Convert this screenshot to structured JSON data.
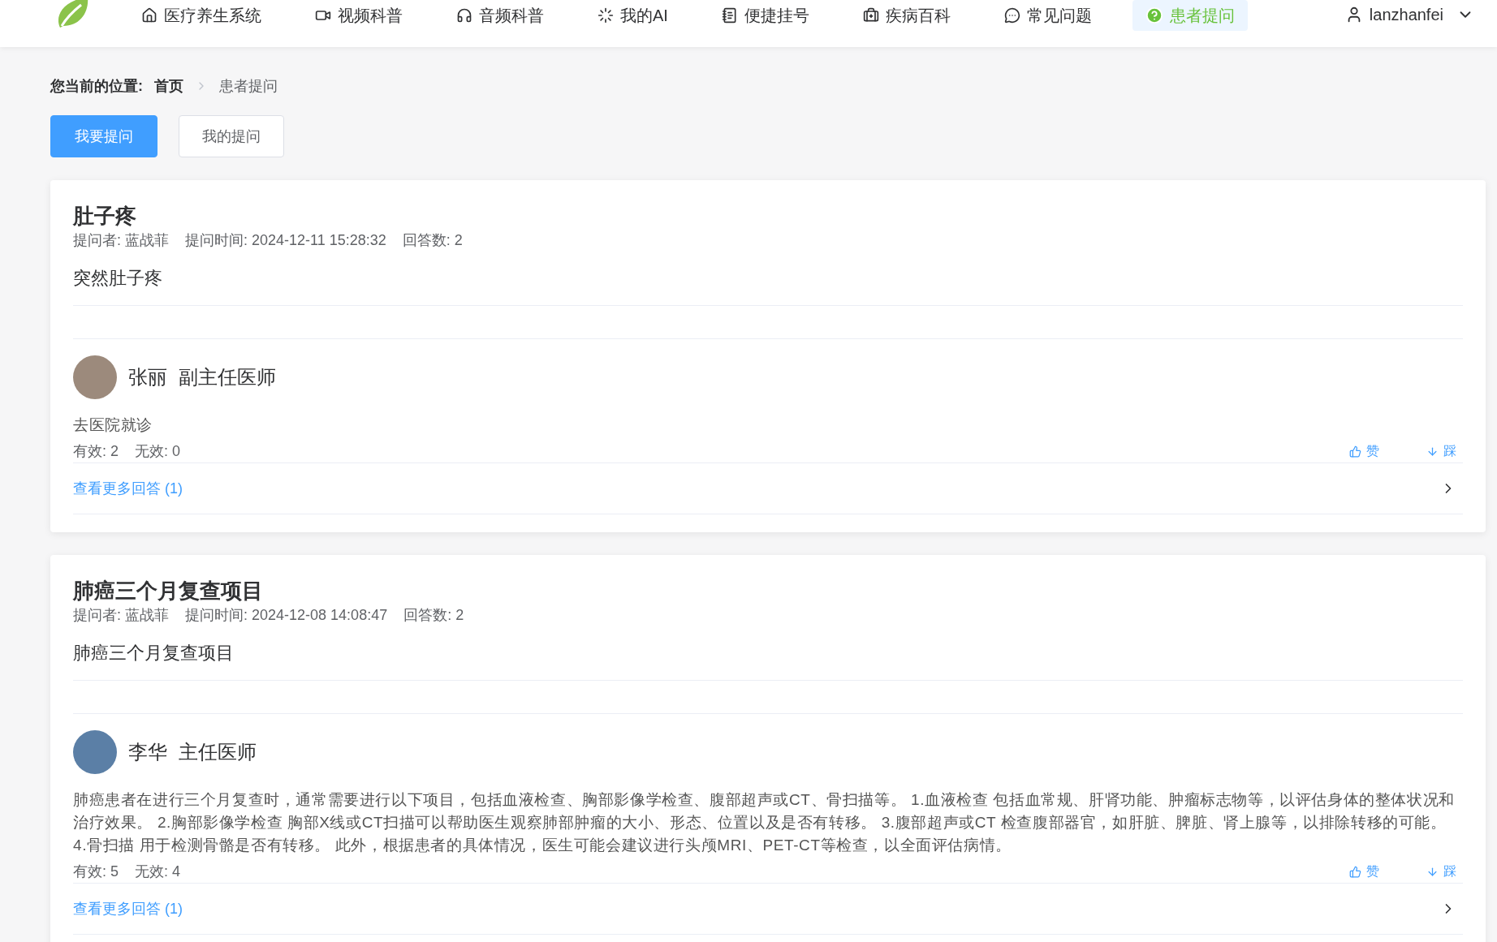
{
  "nav": {
    "items": [
      {
        "label": "医疗养生系统",
        "selected": false
      },
      {
        "label": "视频科普",
        "selected": false
      },
      {
        "label": "音频科普",
        "selected": false
      },
      {
        "label": "我的AI",
        "selected": false
      },
      {
        "label": "便捷挂号",
        "selected": false
      },
      {
        "label": "疾病百科",
        "selected": false
      },
      {
        "label": "常见问题",
        "selected": false
      },
      {
        "label": "患者提问",
        "selected": true
      }
    ],
    "user": "lanzhanfei"
  },
  "breadcrumb": {
    "label": "您当前的位置:",
    "items": [
      "首页",
      "患者提问"
    ]
  },
  "actions": [
    {
      "label": "我要提问",
      "selected": true
    },
    {
      "label": "我的提问",
      "selected": false
    }
  ],
  "questions": [
    {
      "title": "肚子疼",
      "asker": "提问者: 蓝战菲",
      "time": "提问时间: 2024-12-11 15:28:32",
      "answer_count": "回答数: 2",
      "body": "突然肚子疼",
      "answer": {
        "doctor": "张丽",
        "rank": "副主任医师",
        "text": "去医院就诊",
        "useful": "有效: 2",
        "useless": "无效: 0",
        "like": "赞",
        "dislike": "踩"
      },
      "more": "查看更多回答 (1)"
    },
    {
      "title": "肺癌三个月复查项目",
      "asker": "提问者: 蓝战菲",
      "time": "提问时间: 2024-12-08 14:08:47",
      "answer_count": "回答数: 2",
      "body": "肺癌三个月复查项目",
      "answer": {
        "doctor": "李华",
        "rank": "主任医师",
        "text": "肺癌患者在进行三个月复查时，通常需要进行以下项目，包括血液检查、胸部影像学检查、腹部超声或CT、骨扫描等。 1.血液检查 包括血常规、肝肾功能、肿瘤标志物等，以评估身体的整体状况和治疗效果。 2.胸部影像学检查 胸部X线或CT扫描可以帮助医生观察肺部肿瘤的大小、形态、位置以及是否有转移。 3.腹部超声或CT 检查腹部器官，如肝脏、脾脏、肾上腺等，以排除转移的可能。 4.骨扫描 用于检测骨骼是否有转移。 此外，根据患者的具体情况，医生可能会建议进行头颅MRI、PET-CT等检查，以全面评估病情。",
        "useful": "有效: 5",
        "useless": "无效: 4",
        "like": "赞",
        "dislike": "踩"
      },
      "more": "查看更多回答 (1)"
    }
  ]
}
